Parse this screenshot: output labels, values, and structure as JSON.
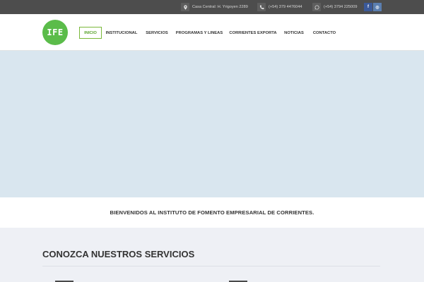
{
  "topbar": {
    "address": "Casa Central: H. Yrigoyen 2289",
    "phone": "(+54) 379 4476044",
    "whatsapp": "(+54) 3794 225009",
    "social": [
      {
        "label": "f",
        "color": "#3b5998"
      },
      {
        "label": "◎",
        "color": "#5b7fb0"
      }
    ]
  },
  "brand": {
    "logo_text": "IFE",
    "logo_color": "#5bbc4a"
  },
  "nav": {
    "items": [
      {
        "label": "INICIO",
        "active": true
      },
      {
        "label": "INSTITUCIONAL",
        "active": false
      },
      {
        "label": "SERVICIOS",
        "active": false
      },
      {
        "label": "PROGRAMAS Y LINEAS",
        "active": false
      },
      {
        "label": "CORRIENTES EXPORTA",
        "active": false
      },
      {
        "label": "NOTICIAS",
        "active": false
      },
      {
        "label": "CONTACTO",
        "active": false
      }
    ]
  },
  "welcome": {
    "text": "BIENVENIDOS AL INSTITUTO DE FOMENTO EMPRESARIAL DE CORRIENTES."
  },
  "services": {
    "title": "CONOZCA NUESTROS SERVICIOS"
  }
}
